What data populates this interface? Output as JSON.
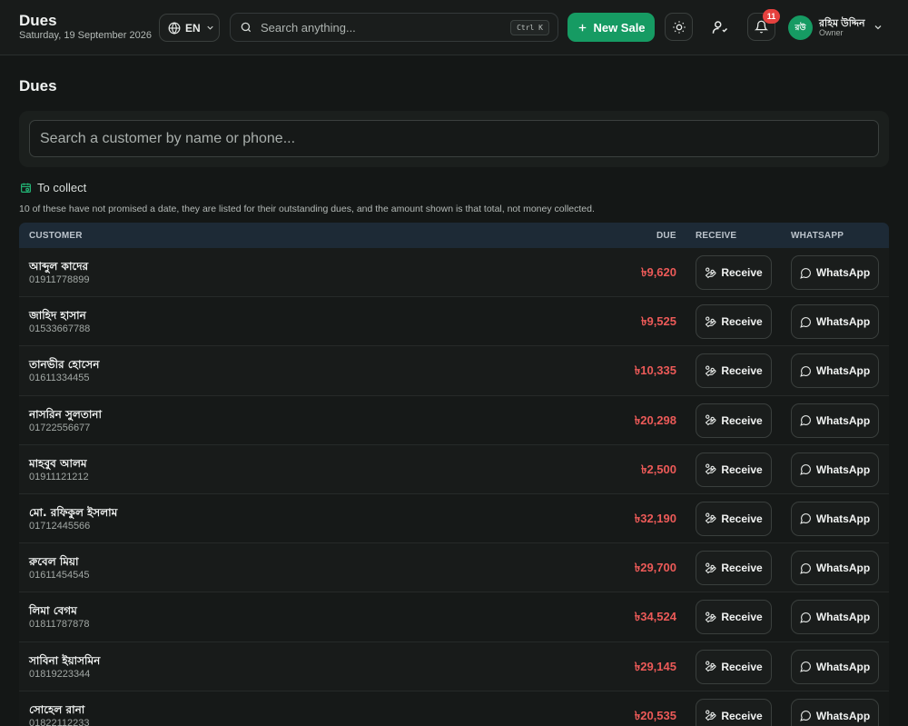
{
  "header": {
    "title": "Dues",
    "date": "Saturday, 19 September 2026",
    "language": "EN",
    "search_placeholder": "Search anything...",
    "search_shortcut": "Ctrl K",
    "new_sale_label": "New Sale",
    "notification_count": "11",
    "user": {
      "initials": "রউ",
      "name": "রহিম উদ্দিন",
      "role": "Owner"
    }
  },
  "page": {
    "title": "Dues",
    "search_placeholder": "Search a customer by name or phone...",
    "section_title": "To collect",
    "section_note": "10 of these have not promised a date, they are listed for their outstanding dues, and the amount shown is that total, not money collected."
  },
  "table": {
    "columns": {
      "customer": "CUSTOMER",
      "due": "DUE",
      "receive": "RECEIVE",
      "whatsapp": "WHATSAPP"
    },
    "receive_label": "Receive",
    "whatsapp_label": "WhatsApp",
    "rows": [
      {
        "name": "আব্দুল কাদের",
        "phone": "01911778899",
        "due": "৳9,620"
      },
      {
        "name": "জাহিদ হাসান",
        "phone": "01533667788",
        "due": "৳9,525"
      },
      {
        "name": "তানভীর হোসেন",
        "phone": "01611334455",
        "due": "৳10,335"
      },
      {
        "name": "নাসরিন সুলতানা",
        "phone": "01722556677",
        "due": "৳20,298"
      },
      {
        "name": "মাহবুব আলম",
        "phone": "01911121212",
        "due": "৳2,500"
      },
      {
        "name": "মো. রফিকুল ইসলাম",
        "phone": "01712445566",
        "due": "৳32,190"
      },
      {
        "name": "রুবেল মিয়া",
        "phone": "01611454545",
        "due": "৳29,700"
      },
      {
        "name": "লিমা বেগম",
        "phone": "01811787878",
        "due": "৳34,524"
      },
      {
        "name": "সাবিনা ইয়াসমিন",
        "phone": "01819223344",
        "due": "৳29,145"
      },
      {
        "name": "সোহেল রানা",
        "phone": "01822112233",
        "due": "৳20,535"
      }
    ]
  },
  "colors": {
    "accent": "#169b63",
    "due": "#ec5a58",
    "badge": "#e5413e",
    "table_header": "#1d2a36"
  }
}
